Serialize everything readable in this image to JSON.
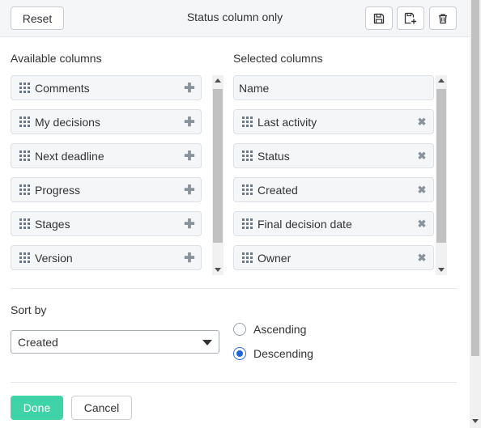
{
  "header": {
    "reset_label": "Reset",
    "title": "Status column only",
    "save_icon": "save-icon",
    "save_as_icon": "save-as-icon",
    "delete_icon": "trash-icon"
  },
  "available": {
    "heading": "Available columns",
    "items": [
      "Comments",
      "My decisions",
      "Next deadline",
      "Progress",
      "Stages",
      "Version"
    ],
    "action_glyph": "✚"
  },
  "selected": {
    "heading": "Selected columns",
    "fixed_item": "Name",
    "items": [
      "Last activity",
      "Status",
      "Created",
      "Final decision date",
      "Owner"
    ],
    "remove_glyph": "✖"
  },
  "sort": {
    "heading": "Sort by",
    "selected_value": "Created",
    "options": [
      {
        "label": "Ascending",
        "checked": false
      },
      {
        "label": "Descending",
        "checked": true
      }
    ]
  },
  "footer": {
    "done_label": "Done",
    "cancel_label": "Cancel"
  },
  "colors": {
    "done_button": "#3fd4a7",
    "radio_selected": "#1f64d6",
    "item_background": "#f4f6f8"
  }
}
